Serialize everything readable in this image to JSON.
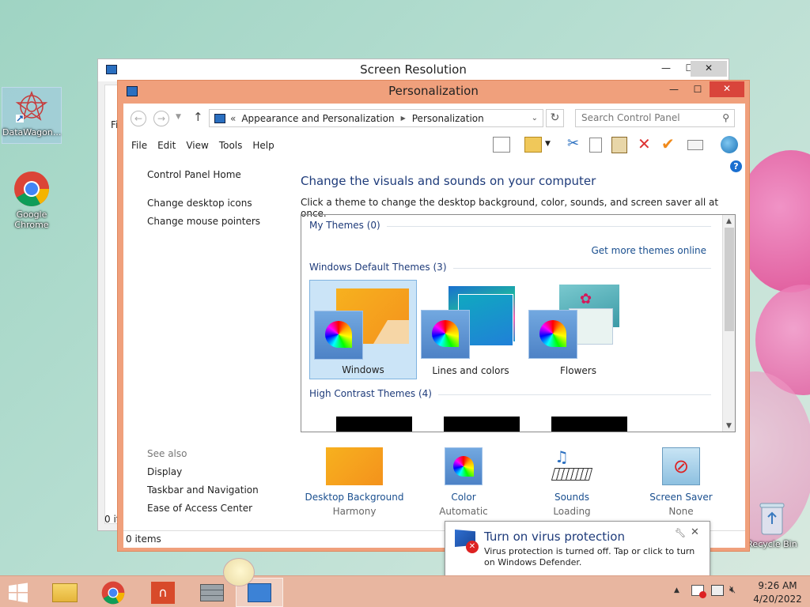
{
  "desktop": {
    "icons": [
      {
        "label": "DataWagon..."
      },
      {
        "label": "Google Chrome"
      },
      {
        "label": "Recycle Bin"
      }
    ]
  },
  "screen_resolution": {
    "title": "Screen Resolution",
    "partial_left": "Fi",
    "partial_bottom": "0 it"
  },
  "personalization": {
    "title": "Personalization",
    "breadcrumb": [
      "Appearance and Personalization",
      "Personalization"
    ],
    "breadcrumb_prefix": "«",
    "search_placeholder": "Search Control Panel",
    "menu": [
      "File",
      "Edit",
      "View",
      "Tools",
      "Help"
    ],
    "sidebar": {
      "home": "Control Panel Home",
      "links": [
        "Change desktop icons",
        "Change mouse pointers"
      ],
      "see_also_label": "See also",
      "see_also": [
        "Display",
        "Taskbar and Navigation",
        "Ease of Access Center"
      ]
    },
    "heading": "Change the visuals and sounds on your computer",
    "instruction": "Click a theme to change the desktop background, color, sounds, and screen saver all at once.",
    "my_themes": "My Themes (0)",
    "get_more": "Get more themes online",
    "default_themes": "Windows Default Themes (3)",
    "themes": [
      {
        "label": "Windows",
        "selected": true
      },
      {
        "label": "Lines and colors",
        "selected": false
      },
      {
        "label": "Flowers",
        "selected": false
      }
    ],
    "high_contrast": "High Contrast Themes (4)",
    "bottom": [
      {
        "label": "Desktop Background",
        "sub": "Harmony"
      },
      {
        "label": "Color",
        "sub": "Automatic"
      },
      {
        "label": "Sounds",
        "sub": "Loading"
      },
      {
        "label": "Screen Saver",
        "sub": "None"
      }
    ],
    "status": "0 items",
    "help": "?"
  },
  "notification": {
    "title": "Turn on virus protection",
    "body": "Virus protection is turned off. Tap or click to turn on Windows Defender."
  },
  "taskbar": {
    "time": "9:26 AM",
    "date": "4/20/2022"
  },
  "colors": {
    "title_active": "#f0a07c",
    "title_close": "#d9453b",
    "taskbar": "#e8b6a0",
    "link": "#1a4f8f"
  }
}
